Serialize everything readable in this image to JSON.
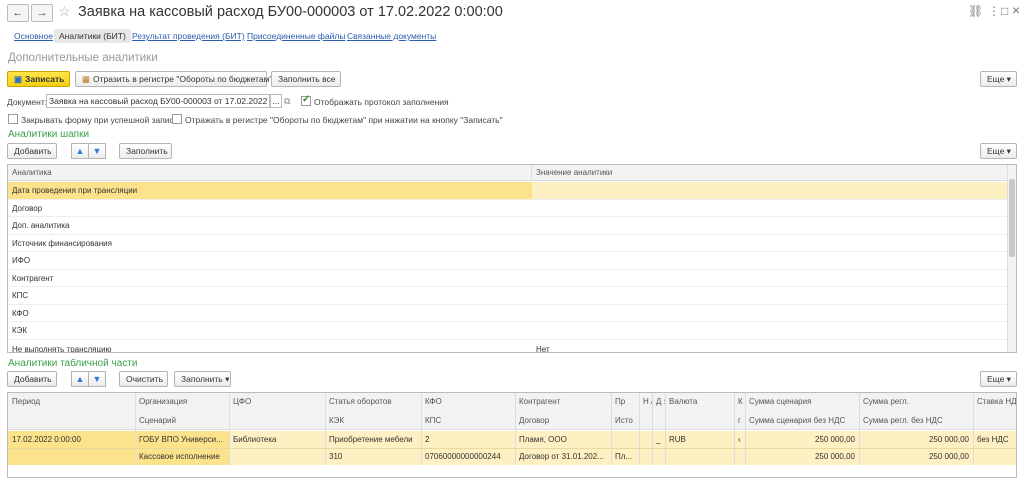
{
  "window": {
    "title": "Заявка на кассовый расход БУ00-000003 от 17.02.2022 0:00:00",
    "back_glyph": "←",
    "forward_glyph": "→",
    "star_glyph": "☆",
    "link_glyph": "🔗",
    "menu_glyph": "⋮",
    "maximize_glyph": "□",
    "close_glyph": "×"
  },
  "tabs": [
    {
      "label": "Основное"
    },
    {
      "label": "Аналитики (БИТ)"
    },
    {
      "label": "Результат проведения (БИТ)"
    },
    {
      "label": "Присоединенные файлы"
    },
    {
      "label": "Связанные документы"
    }
  ],
  "section_title": "Дополнительные аналитики",
  "toolbar": {
    "save_label": "Записать",
    "reflect_label": "Отразить в регистре \"Обороты по бюджетам\"",
    "fill_all_label": "Заполнить все",
    "more_label": "Еще ▾"
  },
  "document": {
    "label": "Документ:",
    "value": "Заявка на кассовый расход БУ00-000003 от 17.02.2022 0:00:00",
    "dots": "...",
    "show_protocol_label": "Отображать протокол заполнения",
    "show_protocol_checked": true,
    "close_form_label": "Закрывать форму при успешной записи",
    "close_form_checked": false,
    "reflect_on_save_label": "Отражать в регистре \"Обороты по бюджетам\" при нажатии на кнопку \"Записать\"",
    "reflect_on_save_checked": false
  },
  "header_analytics": {
    "title": "Аналитики шапки",
    "add_label": "Добавить",
    "fill_label": "Заполнить",
    "more_label": "Еще ▾",
    "columns": [
      "Аналитика",
      "Значение аналитики"
    ],
    "rows": [
      {
        "name": "Дата проведения при трансляции",
        "value": ""
      },
      {
        "name": "Договор",
        "value": ""
      },
      {
        "name": "Доп. аналитика",
        "value": ""
      },
      {
        "name": "Источник финансирования",
        "value": ""
      },
      {
        "name": "ИФО",
        "value": ""
      },
      {
        "name": "Контрагент",
        "value": ""
      },
      {
        "name": "КПС",
        "value": ""
      },
      {
        "name": "КФО",
        "value": ""
      },
      {
        "name": "КЭК",
        "value": ""
      },
      {
        "name": "Не выполнять трансляцию",
        "value": "Нет"
      }
    ]
  },
  "table_analytics": {
    "title": "Аналитики табличной части",
    "add_label": "Добавить",
    "clear_label": "Очистить",
    "fill_label": "Заполнить ▾",
    "more_label": "Еще ▾",
    "headers_top": [
      "Период",
      "Организация",
      "ЦФО",
      "Статья оборотов",
      "КФО",
      "Контрагент",
      "Пр",
      "Н /",
      "Д з",
      "Валюта",
      "К о",
      "Сумма сценария",
      "Сумма регл.",
      "Ставка НД"
    ],
    "headers_bottom": [
      "",
      "Сценарий",
      "",
      "КЭК",
      "КПС",
      "Договор",
      "Исто",
      "",
      "",
      "",
      "г",
      "Сумма сценария без НДС",
      "Сумма регл. без НДС",
      ""
    ],
    "row_top": [
      "17.02.2022 0:00:00",
      "ГОБУ ВПО Универси...",
      "Библиотека",
      "Приобретение мебели",
      "2",
      "Пламя, ООО",
      "",
      "",
      "_",
      "RUB",
      "‹",
      "250 000,00",
      "250 000,00",
      "без НДС"
    ],
    "row_bottom": [
      "",
      "Кассовое исполнение",
      "",
      "310",
      "07060000000000244",
      "Договор от 31.01.202...",
      "Пл...",
      "",
      "",
      "",
      "",
      "250 000,00",
      "250 000,00",
      ""
    ]
  },
  "icons": {
    "up": "🡅",
    "down": "🡇",
    "save": "💾",
    "register": "▦",
    "copy": "⧉"
  }
}
